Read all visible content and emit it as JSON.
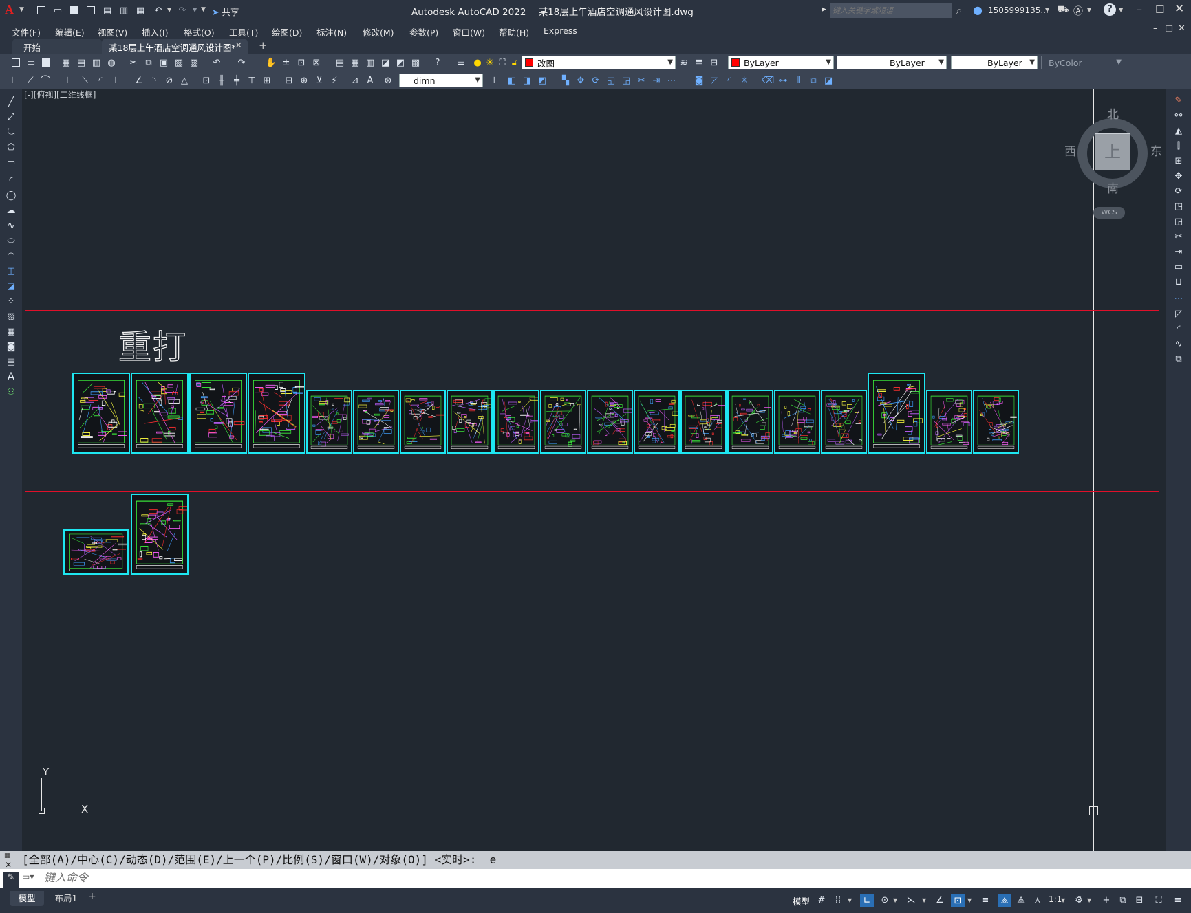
{
  "title_bar": {
    "app_title": "Autodesk AutoCAD 2022",
    "file_title": "某18层上午酒店空调通风设计图.dwg",
    "share_label": "共享",
    "search_placeholder": "键入关键字或短语",
    "user_name": "1505999135...",
    "window_buttons": [
      "minimize",
      "maximize",
      "close"
    ]
  },
  "menu": {
    "items": [
      "文件(F)",
      "编辑(E)",
      "视图(V)",
      "插入(I)",
      "格式(O)",
      "工具(T)",
      "绘图(D)",
      "标注(N)",
      "修改(M)",
      "参数(P)",
      "窗口(W)",
      "帮助(H)",
      "Express"
    ]
  },
  "tabs": {
    "start_label": "开始",
    "active_label": "某18层上午酒店空调通风设计图*",
    "add_label": "+"
  },
  "toolbar": {
    "layer_name": "改图",
    "layer_color": "#ff0000",
    "color_combo": "ByLayer",
    "linetype_combo": "ByLayer",
    "lineweight_combo": "ByLayer",
    "plotstyle_combo": "ByColor",
    "dimstyle_combo": "dimn"
  },
  "viewport": {
    "label": "[-][俯视][二维线框]",
    "viewcube": {
      "north": "北",
      "south": "南",
      "east": "东",
      "west": "西",
      "top": "上",
      "wcs": "WCS"
    },
    "ucs": {
      "x_label": "X",
      "y_label": "Y"
    },
    "annotation": "重打",
    "highlight_color": "#e0102a",
    "sheet_border_color": "#1ee6f0"
  },
  "command": {
    "history": "[全部(A)/中心(C)/动态(D)/范围(E)/上一个(P)/比例(S)/窗口(W)/对象(O)] <实时>: _e",
    "placeholder": "键入命令"
  },
  "status_bar": {
    "model_tab": "模型",
    "layout_tab": "布局1",
    "add_label": "+",
    "model_button": "模型",
    "scale": "1:1"
  }
}
